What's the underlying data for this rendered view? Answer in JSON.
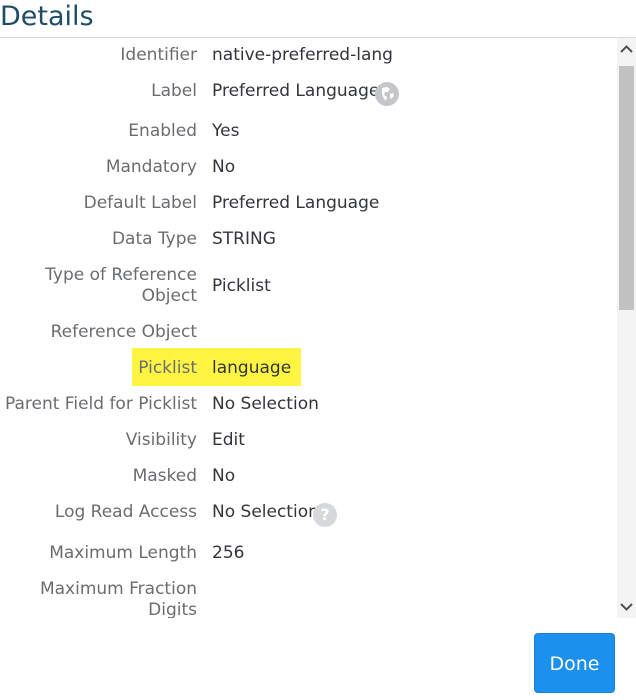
{
  "dialog": {
    "title": "Details"
  },
  "fields": {
    "identifier": {
      "label": "Identifier",
      "value": "native-preferred-lang"
    },
    "label": {
      "label": "Label",
      "value": "Preferred Language",
      "icon": "globe-icon"
    },
    "enabled": {
      "label": "Enabled",
      "value": "Yes"
    },
    "mandatory": {
      "label": "Mandatory",
      "value": "No"
    },
    "default_label": {
      "label": "Default Label",
      "value": "Preferred Language"
    },
    "data_type": {
      "label": "Data Type",
      "value": "STRING"
    },
    "type_of_reference_object": {
      "label": "Type of Reference Object",
      "value": "Picklist"
    },
    "reference_object": {
      "label": "Reference Object",
      "value": ""
    },
    "picklist": {
      "label": "Picklist",
      "value": "language",
      "highlight_color": "#fdf542"
    },
    "parent_field_for_picklist": {
      "label": "Parent Field for Picklist",
      "value": "No Selection"
    },
    "visibility": {
      "label": "Visibility",
      "value": "Edit"
    },
    "masked": {
      "label": "Masked",
      "value": "No"
    },
    "log_read_access": {
      "label": "Log Read Access",
      "value": "No Selection",
      "icon": "help-icon",
      "icon_glyph": "?"
    },
    "maximum_length": {
      "label": "Maximum Length",
      "value": "256"
    },
    "maximum_fraction_digits": {
      "label": "Maximum Fraction Digits",
      "value": ""
    }
  },
  "footer": {
    "done_label": "Done",
    "accent_color": "#1b90ec"
  }
}
